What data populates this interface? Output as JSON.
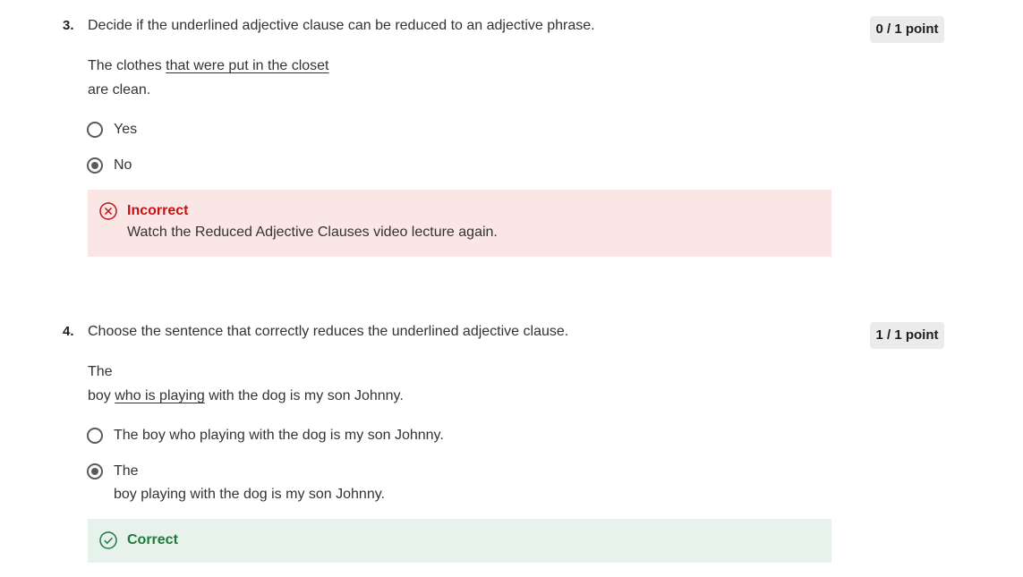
{
  "questions": [
    {
      "number": "3.",
      "prompt": "Decide if the underlined adjective clause can be reduced to an adjective phrase.",
      "points": "0 / 1 point",
      "sentence": {
        "before": "The clothes ",
        "underlined": "that were put in the closet",
        "line2": "are clean."
      },
      "options": [
        {
          "label": "Yes",
          "selected": false
        },
        {
          "label": "No",
          "selected": true
        }
      ],
      "feedback": {
        "status": "incorrect",
        "title": "Incorrect",
        "message": "Watch the Reduced Adjective Clauses video lecture again.",
        "icon": "x-circle-icon",
        "color": "#c21414"
      }
    },
    {
      "number": "4.",
      "prompt": "Choose the sentence that correctly reduces the underlined adjective clause.",
      "points": "1 / 1 point",
      "sentence": {
        "line1": "The",
        "before": "boy ",
        "underlined": "who is playing",
        "after": " with the dog is my son Johnny."
      },
      "options": [
        {
          "label": "The boy who playing with the dog is my son Johnny.",
          "selected": false
        },
        {
          "label_line1": "The",
          "label_line2": "boy playing with the dog is my son Johnny.",
          "selected": true
        }
      ],
      "feedback": {
        "status": "correct",
        "title": "Correct",
        "icon": "check-circle-icon",
        "color": "#1e7a3c"
      }
    }
  ]
}
